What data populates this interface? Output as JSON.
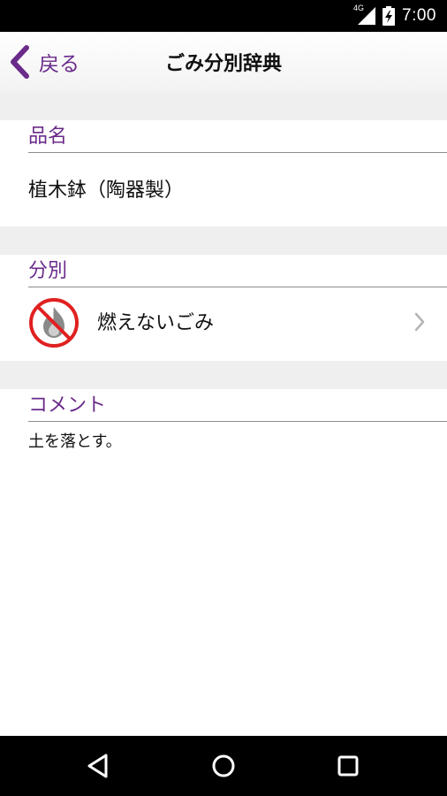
{
  "status_bar": {
    "network": "4G",
    "time": "7:00",
    "icons": [
      "signal-icon",
      "battery-icon"
    ]
  },
  "header": {
    "back_label": "戻る",
    "title": "ごみ分別辞典",
    "accent_color": "#6a2b8a"
  },
  "sections": {
    "item": {
      "heading": "品名",
      "value": "植木鉢（陶器製）"
    },
    "category": {
      "heading": "分別",
      "value": "燃えないごみ",
      "icon": "no-burn-icon"
    },
    "comment": {
      "heading": "コメント",
      "value": "土を落とす。"
    }
  },
  "system_nav": {
    "icons": [
      "back-triangle-icon",
      "home-circle-icon",
      "recents-square-icon"
    ]
  }
}
